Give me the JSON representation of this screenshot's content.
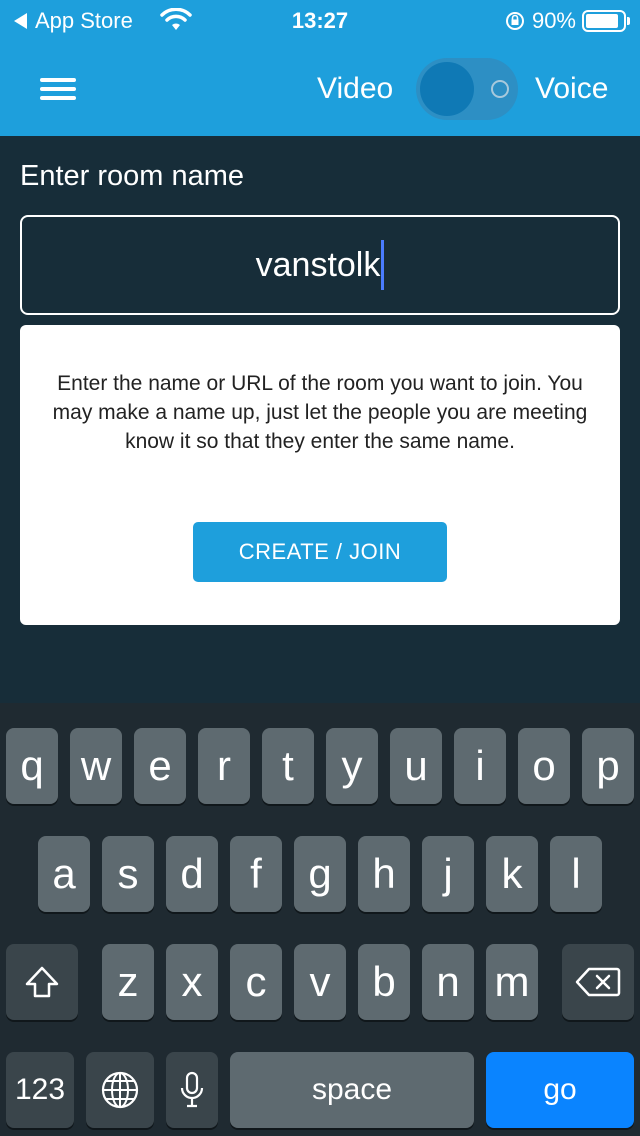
{
  "status_bar": {
    "back_label": "App Store",
    "time": "13:27",
    "battery_percent": "90%",
    "battery_level": 0.9
  },
  "header": {
    "menu_icon": "hamburger-icon",
    "mode_left": "Video",
    "mode_right": "Voice",
    "toggle_state": "video"
  },
  "room": {
    "label": "Enter room name",
    "value": "vanstolk"
  },
  "card": {
    "description": "Enter the name or URL of the room you want to join. You may make a name up, just let the people you are meeting know it so that they enter the same name.",
    "button_label": "CREATE / JOIN"
  },
  "keyboard": {
    "row1": [
      "q",
      "w",
      "e",
      "r",
      "t",
      "y",
      "u",
      "i",
      "o",
      "p"
    ],
    "row2": [
      "a",
      "s",
      "d",
      "f",
      "g",
      "h",
      "j",
      "k",
      "l"
    ],
    "row3": [
      "z",
      "x",
      "c",
      "v",
      "b",
      "n",
      "m"
    ],
    "numbers_label": "123",
    "space_label": "space",
    "go_label": "go"
  },
  "colors": {
    "accent": "#1e9fdc",
    "background": "#172d39",
    "go_key": "#0a84ff"
  }
}
